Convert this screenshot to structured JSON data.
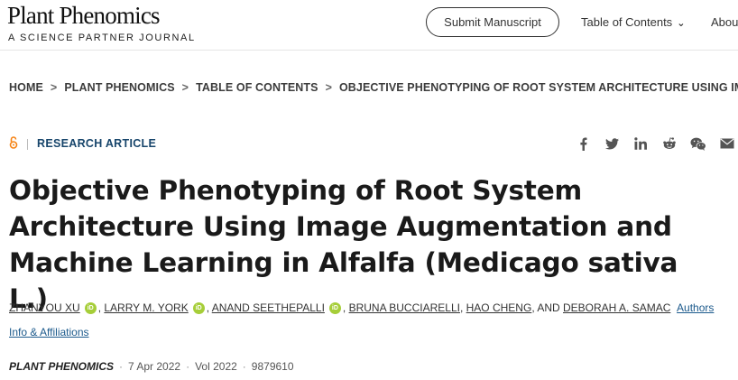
{
  "header": {
    "logo_title": "Plant Phenomics",
    "logo_subtitle": "A SCIENCE PARTNER JOURNAL",
    "submit_label": "Submit Manuscript",
    "nav_toc": "Table of Contents",
    "nav_about": "About"
  },
  "breadcrumb": {
    "items": [
      "HOME",
      "PLANT PHENOMICS",
      "TABLE OF CONTENTS",
      "OBJECTIVE PHENOTYPING OF ROOT SYSTEM ARCHITECTURE USING IMA..."
    ],
    "separator": ">"
  },
  "article": {
    "type": "RESEARCH ARTICLE",
    "title_lines": [
      "Objective Phenotyping of Root System",
      "Architecture Using Image Augmentation and",
      "Machine Learning in Alfalfa (Medicago sativa L.)"
    ],
    "authors": [
      "ZHANYOU XU",
      "LARRY M. YORK",
      "ANAND SEETHEPALLI",
      "BRUNA BUCCIARELLI",
      "HAO CHENG",
      "DEBORAH A. SAMAC"
    ],
    "orcid_label": "iD",
    "and_text": ", AND",
    "authors_info_line1": "Authors Info",
    "authors_info_line2": "& Affiliations",
    "journal": "PLANT PHENOMICS",
    "date": "7 Apr 2022",
    "volume": "Vol 2022",
    "article_number": "9879610"
  },
  "share_icons": [
    "facebook-icon",
    "twitter-icon",
    "linkedin-icon",
    "reddit-icon",
    "wechat-icon",
    "email-icon"
  ],
  "colors": {
    "accent_blue": "#17456b",
    "orcid_green": "#a6ce39",
    "open_access_orange": "#f68212"
  }
}
